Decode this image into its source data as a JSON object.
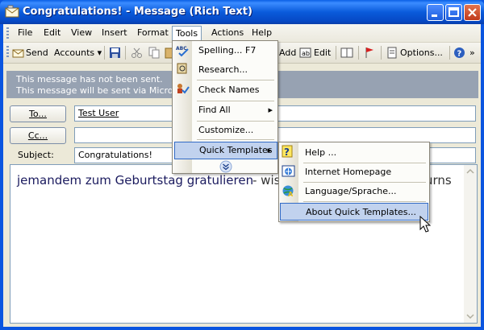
{
  "window": {
    "title": "Congratulations! - Message (Rich Text)"
  },
  "menubar": {
    "items": [
      "File",
      "Edit",
      "View",
      "Insert",
      "Format",
      "Tools",
      "Actions",
      "Help"
    ]
  },
  "toolbar": {
    "send": "Send",
    "accounts": "Accounts",
    "add": "Add",
    "edit": "Edit",
    "options": "Options..."
  },
  "infobar": {
    "line1": "This message has not been sent.",
    "line2": "This message will be sent via Microsoft E"
  },
  "fields": {
    "to_label": "To...",
    "to_value": "Test User",
    "cc_label": "Cc...",
    "cc_value": "",
    "subject_label": "Subject:",
    "subject_value": "Congratulations!"
  },
  "body": {
    "text1": "jemandem zum Geburtstag gratulieren",
    "text2": "-  wis",
    "text3": "urns"
  },
  "tools_menu": {
    "spelling": "Spelling...",
    "spelling_shortcut": "F7",
    "research": "Research...",
    "check_names": "Check Names",
    "find_all": "Find All",
    "customize": "Customize...",
    "quick_templates": "Quick Templates"
  },
  "submenu": {
    "help": "Help ...",
    "homepage": "Internet Homepage",
    "language": "Language/Sprache...",
    "about": "About Quick Templates..."
  },
  "colors": {
    "titlebar": "#0a5bdb",
    "highlight": "#c1d2ee",
    "highlight_border": "#316ac5",
    "infobar": "#97a2b2"
  }
}
